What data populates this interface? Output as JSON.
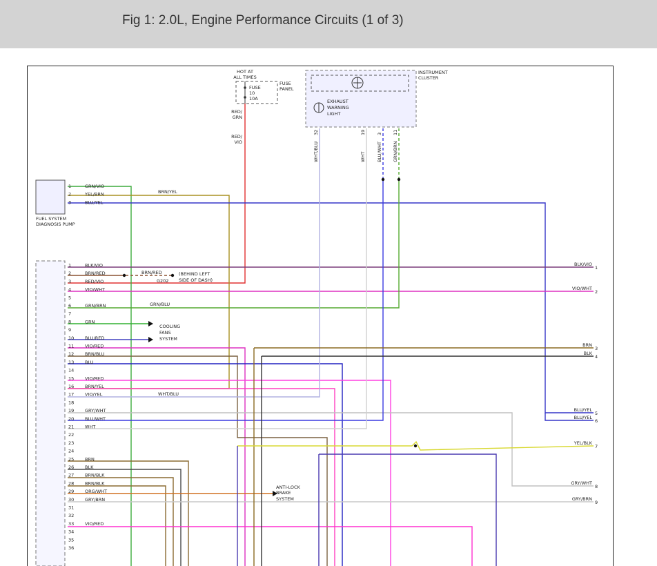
{
  "header": {
    "title": "Fig 1: 2.0L, Engine Performance Circuits (1 of 3)"
  },
  "labels": {
    "hot_at_all_times": [
      "HOT AT",
      "ALL TIMES"
    ],
    "fuse": [
      "FUSE",
      "10",
      "10A"
    ],
    "fuse_panel": [
      "FUSE",
      "PANEL"
    ],
    "red_grn": [
      "RED/",
      "GRN"
    ],
    "red_vio": [
      "RED/",
      "VIO"
    ],
    "instrument_cluster": [
      "INSTRUMENT",
      "CLUSTER"
    ],
    "exhaust_warning_light": [
      "EXHAUST",
      "WARNING",
      "LIGHT"
    ],
    "fuel_system_pump": [
      "FUEL SYSTEM",
      "DIAGNOSIS PUMP"
    ],
    "cooling_fans": [
      "COOLING",
      "FANS",
      "SYSTEM"
    ],
    "abs": [
      "ANTI-LOCK",
      "BRAKE",
      "SYSTEM"
    ],
    "g202": "G202",
    "behind_dash": [
      "(BEHIND LEFT",
      "SIDE OF DASH)"
    ],
    "brn_yel_splice": "BRN/YEL",
    "grn_blu_splice": "GRN/BLU",
    "wht_blu_splice": "WHT/BLU",
    "brn_red_ground": "BRN/RED"
  },
  "cluster_pins": [
    {
      "wire": "WHT/BLU",
      "pin": "32"
    },
    {
      "wire": "WHT",
      "pin": "19"
    },
    {
      "wire": "BLU/WHT",
      "pin": "3"
    },
    {
      "wire": "GRN/BRN",
      "pin": "11"
    }
  ],
  "pump_pins": [
    {
      "pin": "1",
      "wire": "GRN/VIO"
    },
    {
      "pin": "2",
      "wire": "YEL/BRN"
    },
    {
      "pin": "3",
      "wire": "BLU/YEL"
    }
  ],
  "ecm_pins": [
    {
      "pin": "1",
      "wire": "BLK/VIO"
    },
    {
      "pin": "2",
      "wire": "BRN/RED"
    },
    {
      "pin": "3",
      "wire": "RED/VIO"
    },
    {
      "pin": "4",
      "wire": "VIO/WHT"
    },
    {
      "pin": "5",
      "wire": ""
    },
    {
      "pin": "6",
      "wire": "GRN/BRN"
    },
    {
      "pin": "7",
      "wire": ""
    },
    {
      "pin": "8",
      "wire": "GRN"
    },
    {
      "pin": "9",
      "wire": ""
    },
    {
      "pin": "10",
      "wire": "BLU/RED"
    },
    {
      "pin": "11",
      "wire": "VIO/RED"
    },
    {
      "pin": "12",
      "wire": "BRN/BLU"
    },
    {
      "pin": "13",
      "wire": "BLU"
    },
    {
      "pin": "14",
      "wire": ""
    },
    {
      "pin": "15",
      "wire": "VIO/RED"
    },
    {
      "pin": "16",
      "wire": "BRN/YEL"
    },
    {
      "pin": "17",
      "wire": "VIO/YEL"
    },
    {
      "pin": "18",
      "wire": ""
    },
    {
      "pin": "19",
      "wire": "GRY/WHT"
    },
    {
      "pin": "20",
      "wire": "BLU/WHT"
    },
    {
      "pin": "21",
      "wire": "WHT"
    },
    {
      "pin": "22",
      "wire": ""
    },
    {
      "pin": "23",
      "wire": ""
    },
    {
      "pin": "24",
      "wire": ""
    },
    {
      "pin": "25",
      "wire": "BRN"
    },
    {
      "pin": "26",
      "wire": "BLK"
    },
    {
      "pin": "27",
      "wire": "BRN/BLK"
    },
    {
      "pin": "28",
      "wire": "BRN/BLK"
    },
    {
      "pin": "29",
      "wire": "ORG/WHT"
    },
    {
      "pin": "30",
      "wire": "GRY/BRN"
    },
    {
      "pin": "31",
      "wire": ""
    },
    {
      "pin": "32",
      "wire": ""
    },
    {
      "pin": "33",
      "wire": "VIO/RED"
    },
    {
      "pin": "34",
      "wire": ""
    },
    {
      "pin": "35",
      "wire": ""
    },
    {
      "pin": "36",
      "wire": ""
    }
  ],
  "right_outputs": [
    {
      "wire": "BLK/VIO",
      "num": "1"
    },
    {
      "wire": "VIO/WHT",
      "num": "2"
    },
    {
      "wire": "BRN",
      "num": "3"
    },
    {
      "wire": "BLK",
      "num": "4"
    },
    {
      "wire": "BLU/YEL",
      "num": "5"
    },
    {
      "wire": "BLU/YEL",
      "num": "6"
    },
    {
      "wire": "YEL/BLK",
      "num": "7"
    },
    {
      "wire": "GRY/WHT",
      "num": "8"
    },
    {
      "wire": "GRY/BRN",
      "num": "9"
    }
  ]
}
